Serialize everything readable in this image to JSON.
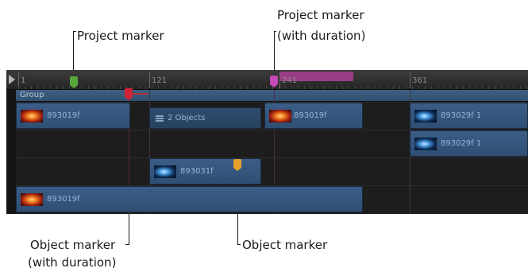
{
  "callouts": {
    "project_marker": "Project marker",
    "project_marker_duration_line1": "Project marker",
    "project_marker_duration_line2": "(with duration)",
    "object_marker_duration_line1": "Object marker",
    "object_marker_duration_line2": "(with duration)",
    "object_marker": "Object marker"
  },
  "ruler": {
    "labels": [
      "1",
      "121",
      "241",
      "361"
    ]
  },
  "group": {
    "label": "Group"
  },
  "clips": {
    "row1_clip1": "893019f",
    "row1_group": "2 Objects",
    "row1_clip2": "893019f",
    "row1_clip3": "893029f 1",
    "row2_clip1": "893029f 1",
    "row3_clip1": "893031f",
    "row4_clip1": "893019f"
  },
  "marker_colors": {
    "project_marker": "#57a73b",
    "project_marker_duration": "#c34ab7",
    "object_marker_duration": "#cf2434",
    "object_marker": "#e6a12c"
  }
}
